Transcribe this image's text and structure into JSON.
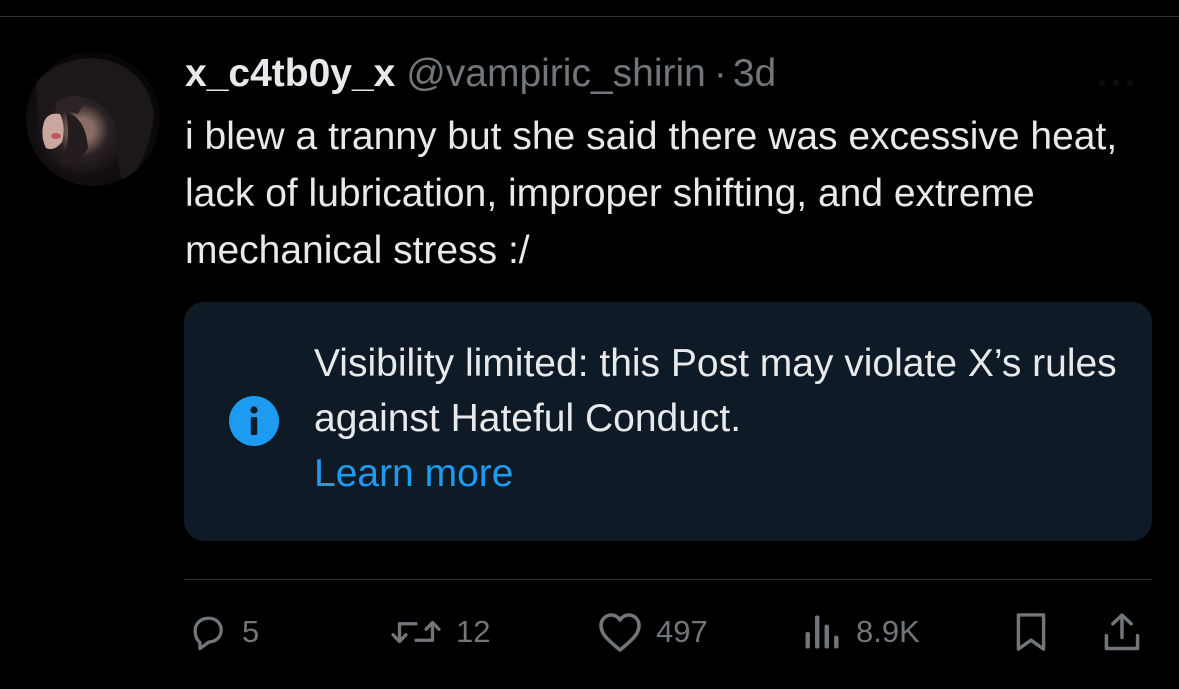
{
  "tweet": {
    "display_name": "x_c4tb0y_x",
    "handle": "@vampiric_shirin",
    "separator": "·",
    "time": "3d",
    "text": "i blew a tranny but she said there was excessive heat, lack of lubrication, improper shifting, and extreme mechanical stress :/"
  },
  "notice": {
    "message": "Visibility limited: this Post may violate X’s rules against Hateful Conduct.",
    "link": "Learn more",
    "icon": "info-icon"
  },
  "actions": {
    "replies": "5",
    "reposts": "12",
    "likes": "497",
    "views": "8.9K"
  },
  "colors": {
    "background": "#000000",
    "text": "#e7e9ea",
    "muted": "#71767b",
    "accent": "#1d9bf0",
    "notice_bg": "#0e1a25",
    "divider": "#2f3336"
  },
  "icons": [
    "reply-icon",
    "repost-icon",
    "like-icon",
    "views-icon",
    "bookmark-icon",
    "share-icon",
    "more-icon"
  ]
}
